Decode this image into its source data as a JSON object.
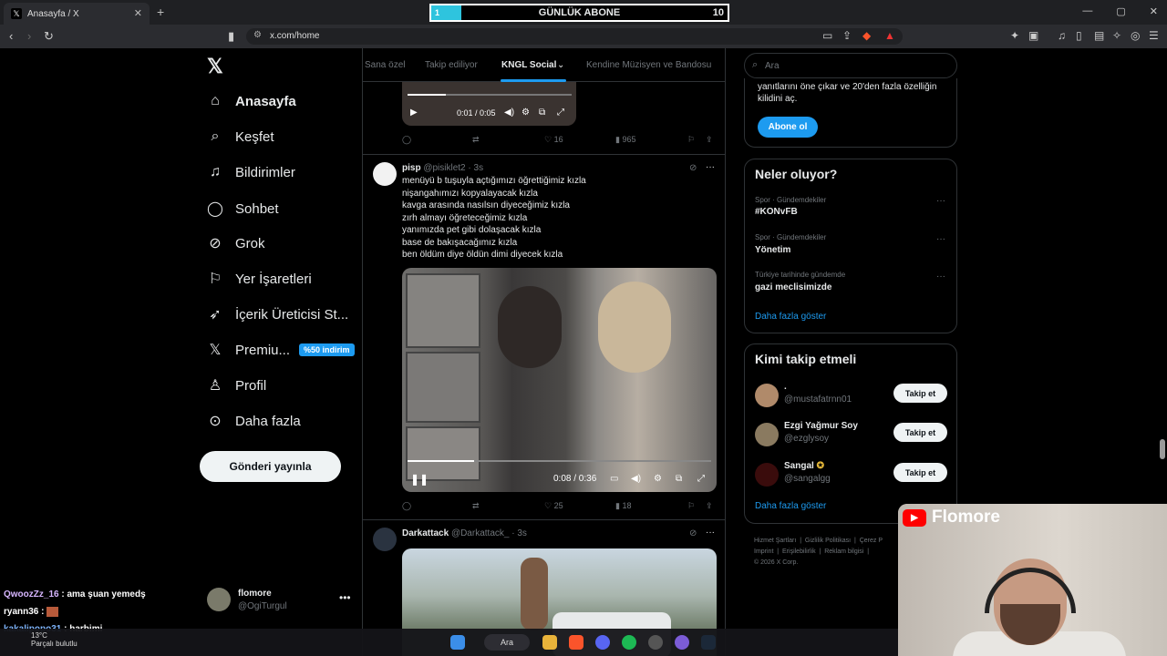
{
  "browser": {
    "tab_title": "Anasayfa / X",
    "tab_icon": "x-logo-icon",
    "new_tab": "+",
    "url": "x.com/home"
  },
  "goal_bar": {
    "label": "GÜNLÜK ABONE",
    "current": "1",
    "target": "10",
    "progress_fraction": 0.1,
    "fill_color": "#2ec4de"
  },
  "sidebar": {
    "items": [
      {
        "label": "Anasayfa",
        "icon": "home-icon"
      },
      {
        "label": "Keşfet",
        "icon": "search-icon"
      },
      {
        "label": "Bildirimler",
        "icon": "bell-icon"
      },
      {
        "label": "Sohbet",
        "icon": "chat-icon"
      },
      {
        "label": "Grok",
        "icon": "grok-icon"
      },
      {
        "label": "Yer İşaretleri",
        "icon": "bookmark-icon"
      },
      {
        "label": "İçerik Üreticisi St...",
        "icon": "rocket-icon"
      },
      {
        "label": "Premiu...",
        "icon": "x-logo-icon"
      },
      {
        "label": "Profil",
        "icon": "person-icon"
      },
      {
        "label": "Daha fazla",
        "icon": "more-circle-icon"
      }
    ],
    "premium_badge": "%50 indirim",
    "post_button": "Gönderi yayınla",
    "account": {
      "name": "flomore",
      "handle": "@OgiTurgul",
      "more": "•••"
    }
  },
  "timeline": {
    "tabs": [
      "Sana özel",
      "Takip ediliyor",
      "KNGL Social",
      "Kendine Müzisyen ve Bandosu"
    ],
    "active_tab": "KNGL Social",
    "tweet0": {
      "time": "0:01 / 0:05",
      "stats": {
        "reply": "",
        "retweet": "",
        "like": "16",
        "views": "965"
      }
    },
    "tweet1": {
      "name": "pisp",
      "handle": "@pisiklet2",
      "age": "· 3s",
      "lines": [
        "menüyü b tuşuyla açtığımızı öğrettiğimiz kızla",
        "nişangahımızı kopyalayacak kızla",
        "kavga arasında nasılsın diyeceğimiz kızla",
        "zırh almayı öğreteceğimiz kızla",
        "yanımızda pet gibi dolaşacak kızla",
        "base de bakışacağımız kızla",
        "ben öldüm diye öldün dimi diyecek kızla"
      ],
      "video_time": "0:08 / 0:36",
      "video_progress_fraction": 0.22,
      "stats": {
        "like": "25",
        "views": "18"
      }
    },
    "tweet2": {
      "name": "Darkattack",
      "handle": "@Darkattack_",
      "age": "· 3s"
    }
  },
  "right": {
    "search_placeholder": "Ara",
    "premium_card": {
      "text": "yanıtlarını öne çıkar ve 20'den fazla özelliğin kilidini aç.",
      "button": "Abone ol"
    },
    "trends": {
      "title": "Neler oluyor?",
      "items": [
        {
          "category": "Spor · Gündemdekiler",
          "title": "#KONvFB"
        },
        {
          "category": "Spor · Gündemdekiler",
          "title": "Yönetim"
        },
        {
          "category": "Türkiye tarihinde gündemde",
          "title": "gazi meclisimizde"
        }
      ],
      "more": "Daha fazla göster"
    },
    "who_to_follow": {
      "title": "Kimi takip etmeli",
      "items": [
        {
          "name": ".",
          "handle": "@mustafatrnn01",
          "button": "Takip et",
          "avatar_color": "#b08a6a"
        },
        {
          "name": "Ezgi Yağmur Soy",
          "handle": "@ezglysoy",
          "button": "Takip et",
          "avatar_color": "#8a7a60"
        },
        {
          "name": "Sangal",
          "handle": "@sangalgg",
          "button": "Takip et",
          "avatar_color": "#8a1a1a"
        }
      ],
      "more": "Daha fazla göster"
    },
    "footer": [
      "Hizmet Şartları",
      "|",
      "Gizlilik Politikası",
      "|",
      "Çerez P",
      "Imprint",
      "|",
      "Erişilebilirlik",
      "|",
      "Reklam bilgisi",
      "|",
      "© 2026 X Corp."
    ]
  },
  "stream": {
    "brand": "Flomore",
    "chat": [
      {
        "user": "QwoozZz_16",
        "message": ": ama şuan yemedş",
        "color": "#d7b6ff"
      },
      {
        "user": "ryann36",
        "message": ":",
        "color": "#ffffff"
      },
      {
        "user": "kakalipopo31",
        "message": ": harbimi",
        "color": "#7fb6ff"
      }
    ],
    "weather": {
      "temp": "13°C",
      "desc": "Parçalı bulutlu"
    },
    "taskbar_search": "Ara"
  }
}
